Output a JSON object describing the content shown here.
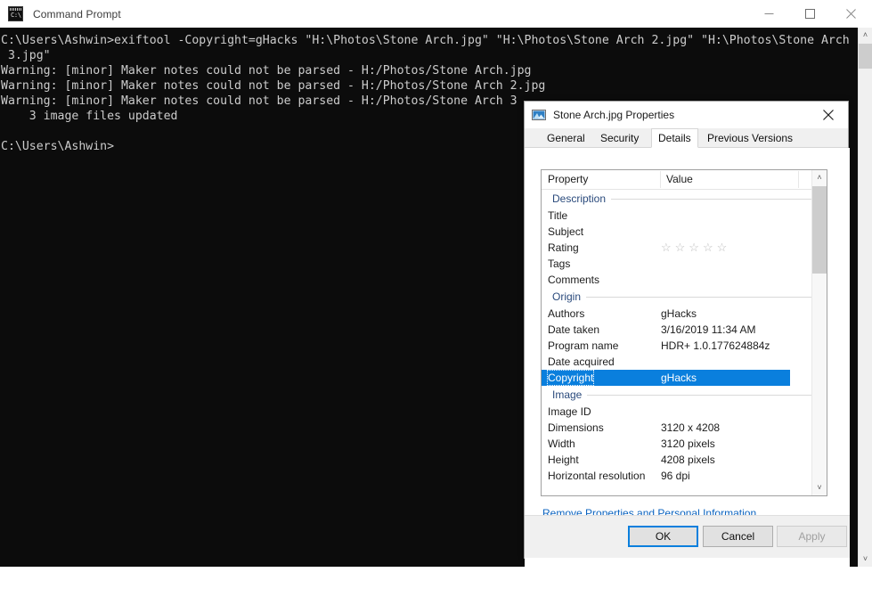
{
  "console": {
    "title": "Command Prompt",
    "icon": "command-prompt-icon",
    "controls": {
      "minimize": "minimize",
      "maximize": "maximize",
      "close": "close"
    },
    "text": "C:\\Users\\Ashwin>exiftool -Copyright=gHacks \"H:\\Photos\\Stone Arch.jpg\" \"H:\\Photos\\Stone Arch 2.jpg\" \"H:\\Photos\\Stone Arch\n 3.jpg\"\nWarning: [minor] Maker notes could not be parsed - H:/Photos/Stone Arch.jpg\nWarning: [minor] Maker notes could not be parsed - H:/Photos/Stone Arch 2.jpg\nWarning: [minor] Maker notes could not be parsed - H:/Photos/Stone Arch 3\n    3 image files updated\n\nC:\\Users\\Ashwin>",
    "scroll_up": "˄",
    "scroll_down": "˅"
  },
  "dialog": {
    "title": "Stone Arch.jpg Properties",
    "icon": "image-file-icon",
    "close_label": "✕",
    "tabs": [
      {
        "label": "General",
        "active": false
      },
      {
        "label": "Security",
        "active": false
      },
      {
        "label": "Details",
        "active": true
      },
      {
        "label": "Previous Versions",
        "active": false
      }
    ],
    "list": {
      "headers": {
        "property": "Property",
        "value": "Value"
      },
      "scroll_up": "˄",
      "scroll_down": "˅",
      "sections": [
        {
          "group": "Description",
          "rows": [
            {
              "name": "Title",
              "value": ""
            },
            {
              "name": "Subject",
              "value": ""
            },
            {
              "name": "Rating",
              "value": "",
              "stars": "☆☆☆☆☆"
            },
            {
              "name": "Tags",
              "value": ""
            },
            {
              "name": "Comments",
              "value": ""
            }
          ]
        },
        {
          "group": "Origin",
          "rows": [
            {
              "name": "Authors",
              "value": "gHacks"
            },
            {
              "name": "Date taken",
              "value": "3/16/2019 11:34 AM"
            },
            {
              "name": "Program name",
              "value": "HDR+ 1.0.177624884z"
            },
            {
              "name": "Date acquired",
              "value": ""
            },
            {
              "name": "Copyright",
              "value": "gHacks",
              "selected": true
            }
          ]
        },
        {
          "group": "Image",
          "rows": [
            {
              "name": "Image ID",
              "value": ""
            },
            {
              "name": "Dimensions",
              "value": "3120 x 4208"
            },
            {
              "name": "Width",
              "value": "3120 pixels"
            },
            {
              "name": "Height",
              "value": "4208 pixels"
            },
            {
              "name": "Horizontal resolution",
              "value": "96 dpi"
            }
          ]
        }
      ]
    },
    "remove_link": "Remove Properties and Personal Information",
    "buttons": {
      "ok": "OK",
      "cancel": "Cancel",
      "apply": "Apply"
    }
  },
  "colors": {
    "selection_blue": "#0a7fdd",
    "link_blue": "#0c64c0",
    "group_header_blue": "#2a4a7c",
    "console_bg": "#0c0c0c",
    "console_fg": "#cccccc"
  }
}
